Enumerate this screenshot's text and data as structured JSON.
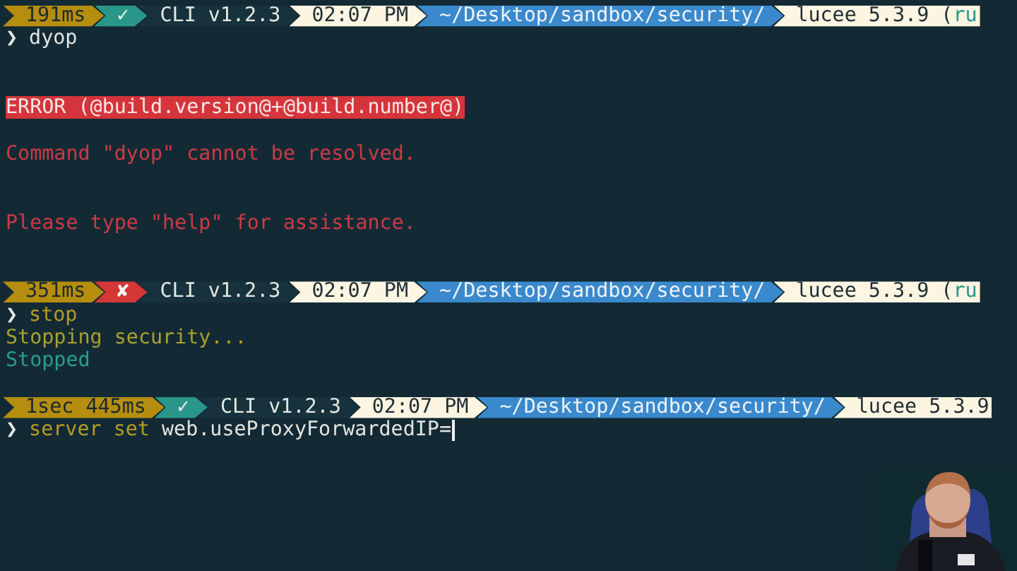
{
  "lines": [
    {
      "kind": "prompt",
      "segments": [
        {
          "kind": "duration",
          "text": "191ms"
        },
        {
          "kind": "status",
          "text": "✓",
          "ok": true
        },
        {
          "kind": "cli",
          "text": "CLI v1.2.3"
        },
        {
          "kind": "clock",
          "text": "02:07 PM"
        },
        {
          "kind": "path",
          "text": "~/Desktop/sandbox/security/"
        },
        {
          "kind": "engine",
          "text": "lucee 5.3.9 (",
          "suffix": "ru"
        }
      ]
    },
    {
      "kind": "command",
      "chevron": "❯",
      "parts": [
        {
          "text": "dyop",
          "accent": false
        }
      ]
    },
    {
      "kind": "blank"
    },
    {
      "kind": "blank"
    },
    {
      "kind": "error_banner",
      "text": "ERROR (@build.version@+@build.number@)"
    },
    {
      "kind": "blank"
    },
    {
      "kind": "error",
      "text": "Command \"dyop\" cannot be resolved."
    },
    {
      "kind": "blank"
    },
    {
      "kind": "blank"
    },
    {
      "kind": "error",
      "text": "Please type \"help\" for assistance."
    },
    {
      "kind": "blank"
    },
    {
      "kind": "blank"
    },
    {
      "kind": "prompt",
      "segments": [
        {
          "kind": "duration",
          "text": "351ms"
        },
        {
          "kind": "status",
          "text": "✘",
          "ok": false
        },
        {
          "kind": "cli",
          "text": "CLI v1.2.3"
        },
        {
          "kind": "clock",
          "text": "02:07 PM"
        },
        {
          "kind": "path",
          "text": "~/Desktop/sandbox/security/"
        },
        {
          "kind": "engine",
          "text": "lucee 5.3.9 (",
          "suffix": "ru"
        }
      ]
    },
    {
      "kind": "command",
      "chevron": "❯",
      "parts": [
        {
          "text": "stop",
          "accent": true
        }
      ]
    },
    {
      "kind": "warning",
      "text": "Stopping security..."
    },
    {
      "kind": "info",
      "text": "Stopped"
    },
    {
      "kind": "blank"
    },
    {
      "kind": "prompt",
      "segments": [
        {
          "kind": "duration",
          "text": "1sec 445ms"
        },
        {
          "kind": "status",
          "text": "✓",
          "ok": true
        },
        {
          "kind": "cli",
          "text": "CLI v1.2.3"
        },
        {
          "kind": "clock",
          "text": "02:07 PM"
        },
        {
          "kind": "path",
          "text": "~/Desktop/sandbox/security/"
        },
        {
          "kind": "engine",
          "text": "lucee 5.3.9"
        }
      ]
    },
    {
      "kind": "command",
      "chevron": "❯",
      "cursor": true,
      "parts": [
        {
          "text": "server set",
          "accent": true
        },
        {
          "text": " web.useProxyForwardedIP=",
          "accent": false
        }
      ]
    }
  ]
}
